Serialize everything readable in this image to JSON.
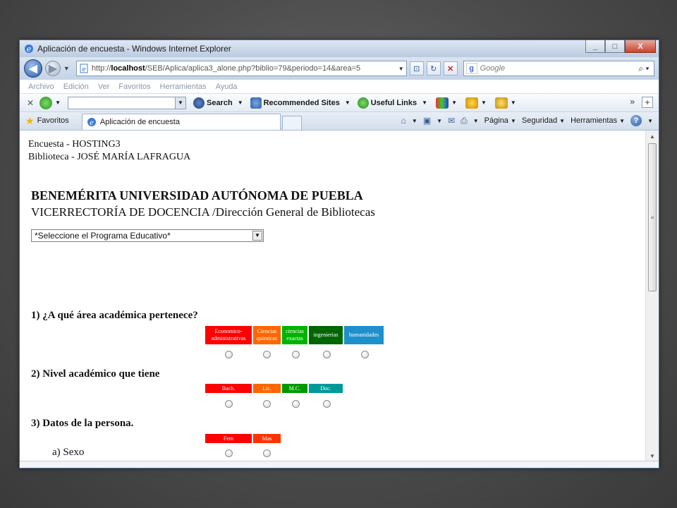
{
  "window": {
    "title": "Aplicación de encuesta - Windows Internet Explorer",
    "buttons": [
      "_",
      "□",
      "X"
    ]
  },
  "address_bar": {
    "url_prefix": "http://",
    "url_host": "localhost",
    "url_path": "/SEB/Aplica/aplica3_alone.php?biblio=79&periodo=14&area=5",
    "search_placeholder": "Google"
  },
  "menu": [
    "Archivo",
    "Edición",
    "Ver",
    "Favoritos",
    "Herramientas",
    "Ayuda"
  ],
  "toolbar": {
    "search_label": "Search",
    "recommended_label": "Recommended Sites",
    "useful_links_label": "Useful Links",
    "overflow": "»"
  },
  "tabs": {
    "favorites_label": "Favoritos",
    "active_tab": "Aplicación de encuesta",
    "commands": [
      "Página",
      "Seguridad",
      "Herramientas"
    ]
  },
  "page": {
    "survey_line": "Encuesta - HOSTING3",
    "library_line": "Biblioteca - JOSÉ MARÍA LAFRAGUA",
    "university": "BENEMÉRITA UNIVERSIDAD AUTÓNOMA DE PUEBLA",
    "department": "VICERRECTORÍA DE DOCENCIA /Dirección General de Bibliotecas",
    "program_select": "*Seleccione el Programa Educativo*",
    "q1": "1) ¿A qué área académica pertenece?",
    "q1_options": [
      {
        "label1": "Economico-",
        "label2": "administrativas",
        "color": "#ff0000"
      },
      {
        "label1": "Ciencias",
        "label2": "quimicas",
        "color": "#ff6600"
      },
      {
        "label1": "ciencias",
        "label2": "exactas",
        "color": "#00b400"
      },
      {
        "label1": "ingenierias",
        "label2": "",
        "color": "#006600"
      },
      {
        "label1": "humanidades",
        "label2": "",
        "color": "#1e90cc"
      }
    ],
    "q2": "2) Nivel académico que tiene",
    "q2_options": [
      {
        "label": "Bach.",
        "color": "#ff0000"
      },
      {
        "label": "Lic.",
        "color": "#ff6600"
      },
      {
        "label": "M.C.",
        "color": "#009900"
      },
      {
        "label": "Doc.",
        "color": "#009999"
      }
    ],
    "q3": "3) Datos de la persona.",
    "q3_options": [
      {
        "label": "Fem",
        "color": "#ff0000"
      },
      {
        "label": "Mas",
        "color": "#ff3300"
      }
    ],
    "q3a": "a) Sexo"
  }
}
